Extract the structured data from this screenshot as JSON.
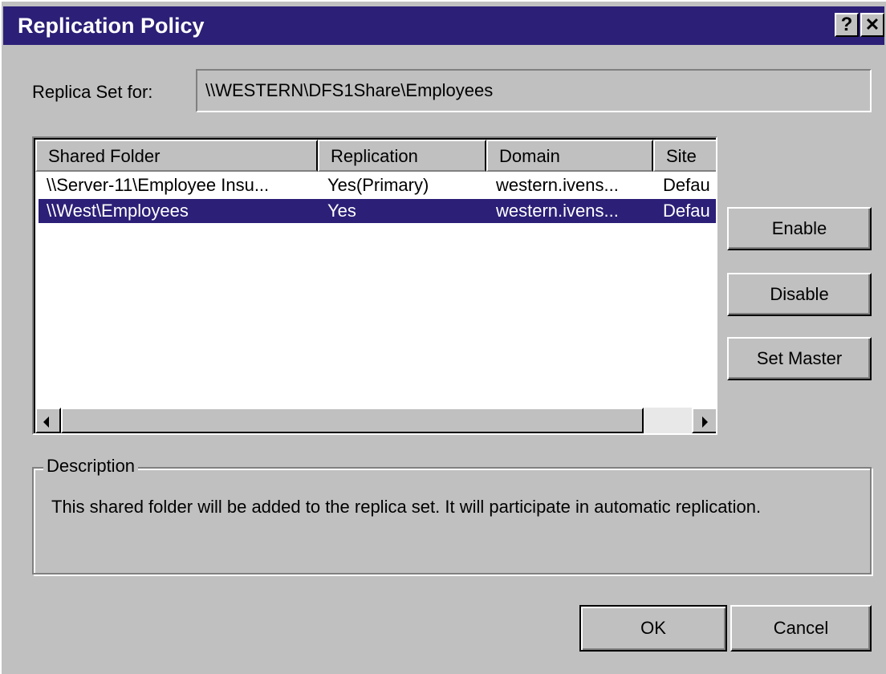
{
  "window": {
    "title": "Replication Policy",
    "help_label": "?",
    "close_label": "✕"
  },
  "replica": {
    "label": "Replica Set for:",
    "value": "\\\\WESTERN\\DFS1Share\\Employees"
  },
  "list": {
    "columns": [
      "Shared Folder",
      "Replication",
      "Domain",
      "Site"
    ],
    "rows": [
      {
        "shared_folder": "\\\\Server-11\\Employee Insu...",
        "replication": "Yes(Primary)",
        "domain": "western.ivens...",
        "site": "Defau",
        "selected": false
      },
      {
        "shared_folder": "\\\\West\\Employees",
        "replication": "Yes",
        "domain": "western.ivens...",
        "site": "Defau",
        "selected": true
      }
    ]
  },
  "buttons": {
    "enable": "Enable",
    "disable": "Disable",
    "set_master": "Set Master",
    "ok": "OK",
    "cancel": "Cancel"
  },
  "description": {
    "legend": "Description",
    "text": "This shared folder will be added to the replica set. It will participate in automatic replication."
  },
  "colors": {
    "titlebar": "#2b1f77",
    "selection": "#2b1f77",
    "face": "#c0c0c0"
  }
}
